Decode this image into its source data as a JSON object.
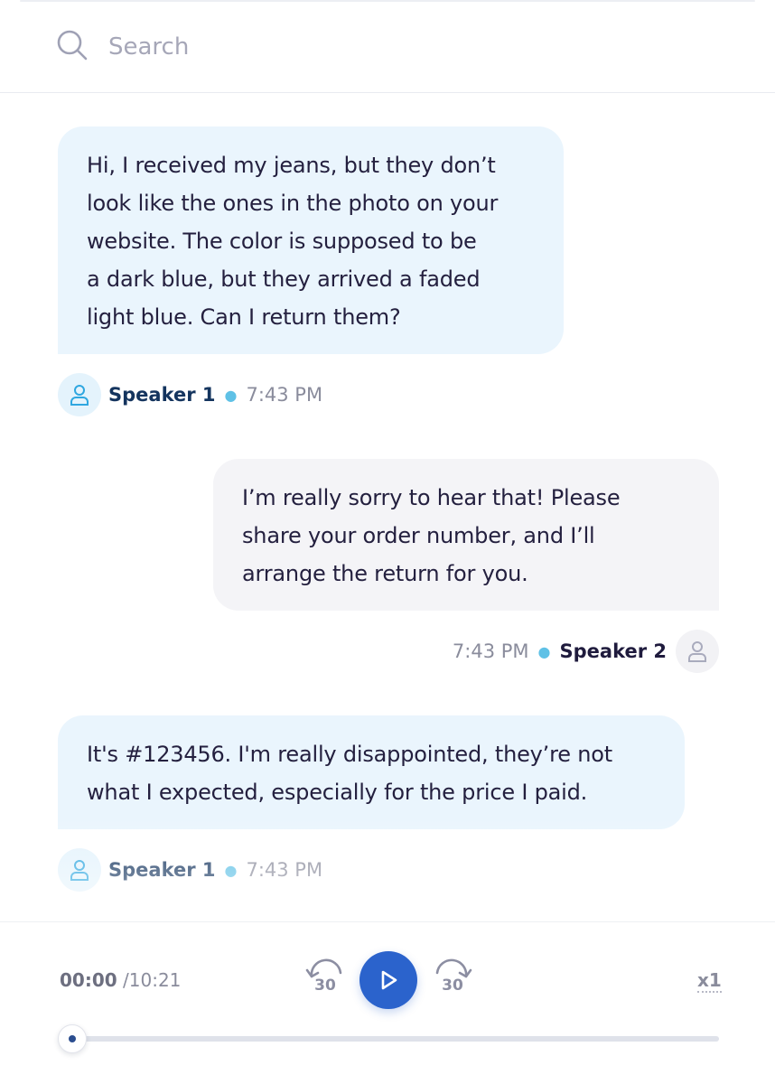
{
  "search": {
    "placeholder": "Search"
  },
  "messages": [
    {
      "speaker": "Speaker 1",
      "time": "7:43 PM",
      "lines": [
        "Hi, I received my jeans, but they don’t",
        "look like the ones in the photo on your",
        "website. The color is supposed to be",
        "a dark blue, but they arrived a faded",
        "light blue. Can I return them?"
      ]
    },
    {
      "speaker": "Speaker 2",
      "time": "7:43 PM",
      "lines": [
        "I’m really sorry to hear that! Please",
        "share your order number, and I’ll",
        "arrange the return for you."
      ]
    },
    {
      "speaker": "Speaker 1",
      "time": "7:43 PM",
      "lines": [
        "It's #123456. I'm really disappointed, they’re not",
        "what I expected, especially for the price I paid."
      ]
    }
  ],
  "player": {
    "current_time": "00:00",
    "total_time": "/10:21",
    "rewind_label": "30",
    "forward_label": "30",
    "speed": "x1",
    "progress_fraction": 0
  },
  "icons": {
    "search": "search-icon",
    "user": "user-icon",
    "rewind": "rewind-30-icon",
    "play": "play-icon",
    "forward": "forward-30-icon"
  },
  "colors": {
    "speaker1_bubble": "#eaf5fd",
    "speaker2_bubble": "#f4f4f7",
    "accent": "#2b63cc",
    "speaker1_icon": "#2fa7e0",
    "speaker2_icon": "#a9abbd"
  }
}
